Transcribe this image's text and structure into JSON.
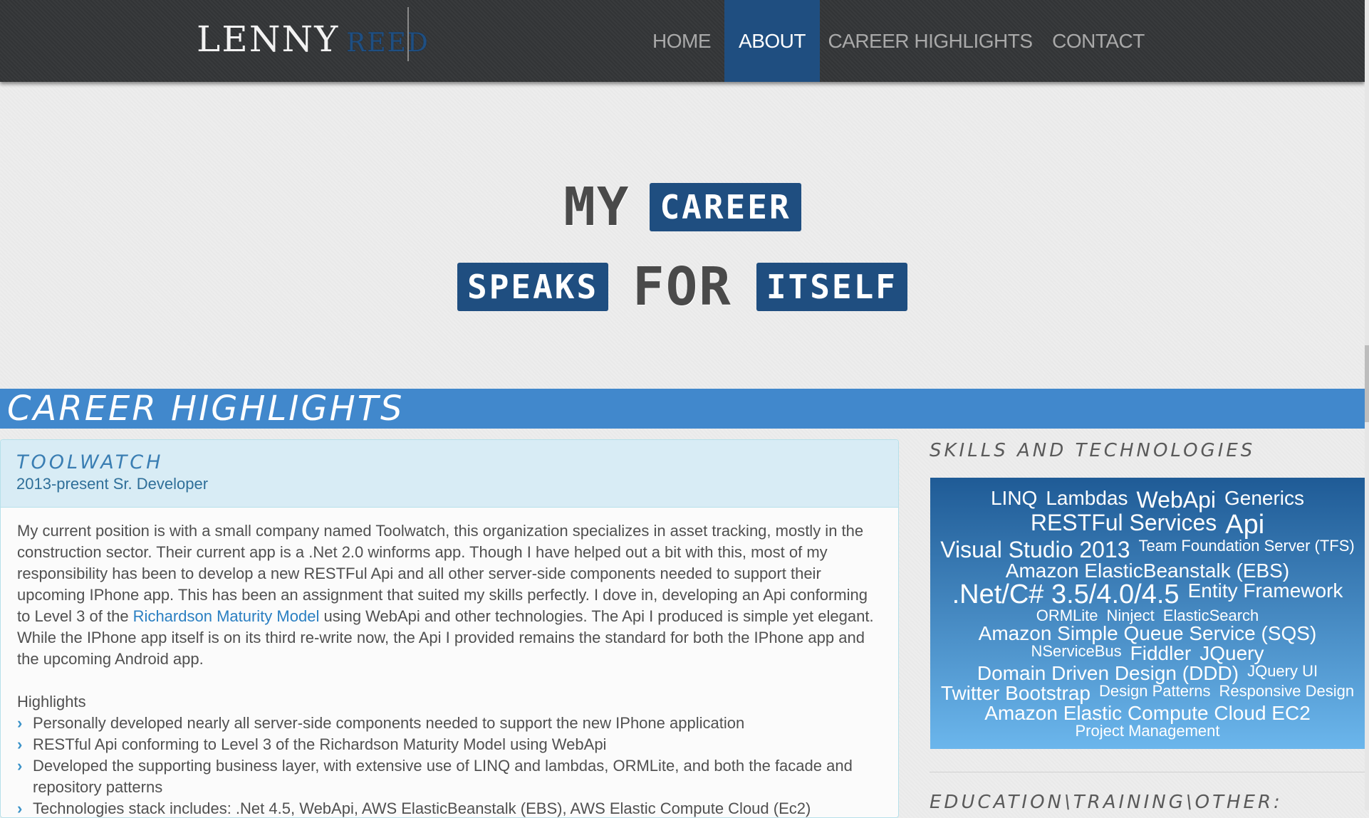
{
  "brand": {
    "first": "LENNY",
    "last": "REED"
  },
  "nav": {
    "items": [
      {
        "label": "HOME",
        "active": false
      },
      {
        "label": "ABOUT",
        "active": true
      },
      {
        "label": "CAREER HIGHLIGHTS",
        "active": false
      },
      {
        "label": "CONTACT",
        "active": false
      }
    ]
  },
  "hero": {
    "line1": {
      "plain": "MY",
      "boxed": "CAREER"
    },
    "line2": {
      "boxed_left": "SPEAKS",
      "plain": "FOR",
      "boxed_right": "ITSELF"
    }
  },
  "section": {
    "title": "CAREER HIGHLIGHTS"
  },
  "job": {
    "company": "TOOLWATCH",
    "role": "2013-present Sr. Developer",
    "description_before_link": "My current position is with a small company named Toolwatch, this organization specializes in asset tracking, mostly in the construction sector. Their current app is a .Net 2.0 winforms app. Though I have helped out a bit with this, most of my responsibility has been to develop a new RESTFul Api and all other server-side components needed to support their upcoming IPhone app. This has been an assignment that suited my skills perfectly. I dove in, developing an Api conforming to Level 3 of the ",
    "link_text": "Richardson Maturity Model",
    "description_after_link": " using WebApi and other technologies. The Api I produced is simple yet elegant. While the IPhone app itself is on its third re-write now, the Api I provided remains the standard for both the IPhone app and the upcoming Android app.",
    "highlights_title": "Highlights",
    "highlights": [
      "Personally developed nearly all server-side components needed to support the new IPhone application",
      "RESTful Api conforming to Level 3 of the Richardson Maturity Model using WebApi",
      "Developed the supporting business layer, with extensive use of LINQ and lambdas, ORMLite, and both the facade and repository patterns",
      "Technologies stack includes: .Net 4.5, WebApi, AWS ElasticBeanstalk (EBS), AWS Elastic Compute Cloud (Ec2)"
    ]
  },
  "skills": {
    "title": "SKILLS AND TECHNOLOGIES",
    "tags": [
      {
        "text": "LINQ",
        "size": "m"
      },
      {
        "text": "Lambdas",
        "size": "m"
      },
      {
        "text": "WebApi",
        "size": "l"
      },
      {
        "text": "Generics",
        "size": "m"
      },
      {
        "text": "RESTFul Services",
        "size": "l"
      },
      {
        "text": "Api",
        "size": "xl"
      },
      {
        "text": "Visual Studio 2013",
        "size": "l"
      },
      {
        "text": "Team Foundation Server (TFS)",
        "size": "s"
      },
      {
        "text": "Amazon ElasticBeanstalk (EBS)",
        "size": "m"
      },
      {
        "text": ".Net/C# 3.5/4.0/4.5",
        "size": "xl"
      },
      {
        "text": "Entity Framework",
        "size": "m"
      },
      {
        "text": "ORMLite",
        "size": "s"
      },
      {
        "text": "Ninject",
        "size": "s"
      },
      {
        "text": "ElasticSearch",
        "size": "s"
      },
      {
        "text": "Amazon Simple Queue Service (SQS)",
        "size": "m"
      },
      {
        "text": "NServiceBus",
        "size": "s"
      },
      {
        "text": "Fiddler",
        "size": "m"
      },
      {
        "text": "JQuery",
        "size": "m"
      },
      {
        "text": "Domain Driven Design (DDD)",
        "size": "m"
      },
      {
        "text": "JQuery UI",
        "size": "s"
      },
      {
        "text": "Twitter Bootstrap",
        "size": "m"
      },
      {
        "text": "Design Patterns",
        "size": "s"
      },
      {
        "text": "Responsive Design",
        "size": "s"
      },
      {
        "text": "Amazon Elastic Compute Cloud EC2",
        "size": "m"
      },
      {
        "text": "Project Management",
        "size": "s"
      }
    ]
  },
  "education": {
    "title": "EDUCATION\\TRAINING\\OTHER:"
  },
  "colors": {
    "accent": "#1f4e80",
    "banner": "#4188cc",
    "navbar": "#343638"
  }
}
